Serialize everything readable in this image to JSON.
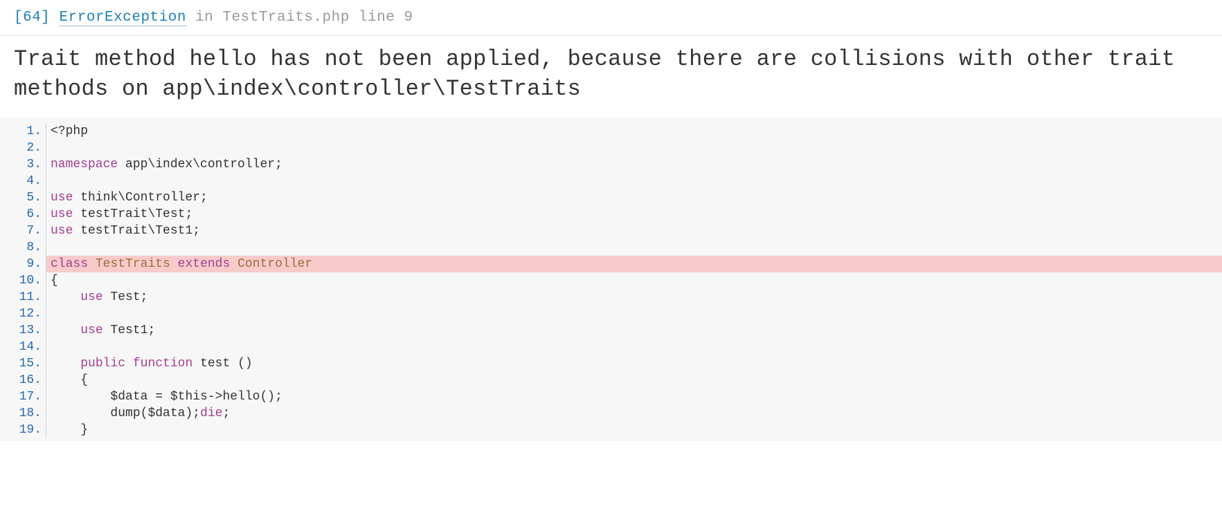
{
  "header": {
    "code": "[64]",
    "exception": "ErrorException",
    "in_word": "in",
    "file": "TestTraits.php line 9"
  },
  "message": "Trait method hello has not been applied, because there are collisions with other trait methods on app\\index\\controller\\TestTraits",
  "code": {
    "start_line": 1,
    "highlight_line": 9,
    "lines": [
      {
        "n": 1,
        "tokens": [
          {
            "t": "<?php",
            "c": "pt"
          }
        ]
      },
      {
        "n": 2,
        "tokens": []
      },
      {
        "n": 3,
        "tokens": [
          {
            "t": "namespace",
            "c": "kw"
          },
          {
            "t": " app\\index\\controller",
            "c": ""
          },
          {
            "t": ";",
            "c": "sym"
          }
        ]
      },
      {
        "n": 4,
        "tokens": []
      },
      {
        "n": 5,
        "tokens": [
          {
            "t": "use",
            "c": "kw"
          },
          {
            "t": " think\\Controller",
            "c": ""
          },
          {
            "t": ";",
            "c": "sym"
          }
        ]
      },
      {
        "n": 6,
        "tokens": [
          {
            "t": "use",
            "c": "kw"
          },
          {
            "t": " testTrait\\Test",
            "c": ""
          },
          {
            "t": ";",
            "c": "sym"
          }
        ]
      },
      {
        "n": 7,
        "tokens": [
          {
            "t": "use",
            "c": "kw"
          },
          {
            "t": " testTrait\\Test1",
            "c": ""
          },
          {
            "t": ";",
            "c": "sym"
          }
        ]
      },
      {
        "n": 8,
        "tokens": []
      },
      {
        "n": 9,
        "tokens": [
          {
            "t": "class",
            "c": "kw"
          },
          {
            "t": " ",
            "c": ""
          },
          {
            "t": "TestTraits",
            "c": "cls"
          },
          {
            "t": " ",
            "c": ""
          },
          {
            "t": "extends",
            "c": "kw"
          },
          {
            "t": " ",
            "c": ""
          },
          {
            "t": "Controller",
            "c": "cls"
          }
        ]
      },
      {
        "n": 10,
        "tokens": [
          {
            "t": "{",
            "c": "sym"
          }
        ]
      },
      {
        "n": 11,
        "tokens": [
          {
            "t": "    ",
            "c": ""
          },
          {
            "t": "use",
            "c": "kw"
          },
          {
            "t": " Test",
            "c": ""
          },
          {
            "t": ";",
            "c": "sym"
          }
        ]
      },
      {
        "n": 12,
        "tokens": []
      },
      {
        "n": 13,
        "tokens": [
          {
            "t": "    ",
            "c": ""
          },
          {
            "t": "use",
            "c": "kw"
          },
          {
            "t": " Test1",
            "c": ""
          },
          {
            "t": ";",
            "c": "sym"
          }
        ]
      },
      {
        "n": 14,
        "tokens": []
      },
      {
        "n": 15,
        "tokens": [
          {
            "t": "    ",
            "c": ""
          },
          {
            "t": "public",
            "c": "kw"
          },
          {
            "t": " ",
            "c": ""
          },
          {
            "t": "function",
            "c": "kw"
          },
          {
            "t": " test ",
            "c": ""
          },
          {
            "t": "()",
            "c": "sym"
          }
        ]
      },
      {
        "n": 16,
        "tokens": [
          {
            "t": "    ",
            "c": ""
          },
          {
            "t": "{",
            "c": "sym"
          }
        ]
      },
      {
        "n": 17,
        "tokens": [
          {
            "t": "        $data ",
            "c": ""
          },
          {
            "t": "=",
            "c": "op"
          },
          {
            "t": " $this",
            "c": ""
          },
          {
            "t": "->",
            "c": "op"
          },
          {
            "t": "hello",
            "c": ""
          },
          {
            "t": "();",
            "c": "sym"
          }
        ]
      },
      {
        "n": 18,
        "tokens": [
          {
            "t": "        dump",
            "c": ""
          },
          {
            "t": "(",
            "c": "sym"
          },
          {
            "t": "$data",
            "c": ""
          },
          {
            "t": ");",
            "c": "sym"
          },
          {
            "t": "die",
            "c": "kw"
          },
          {
            "t": ";",
            "c": "sym"
          }
        ]
      },
      {
        "n": 19,
        "tokens": [
          {
            "t": "    ",
            "c": ""
          },
          {
            "t": "}",
            "c": "sym"
          }
        ]
      }
    ]
  }
}
